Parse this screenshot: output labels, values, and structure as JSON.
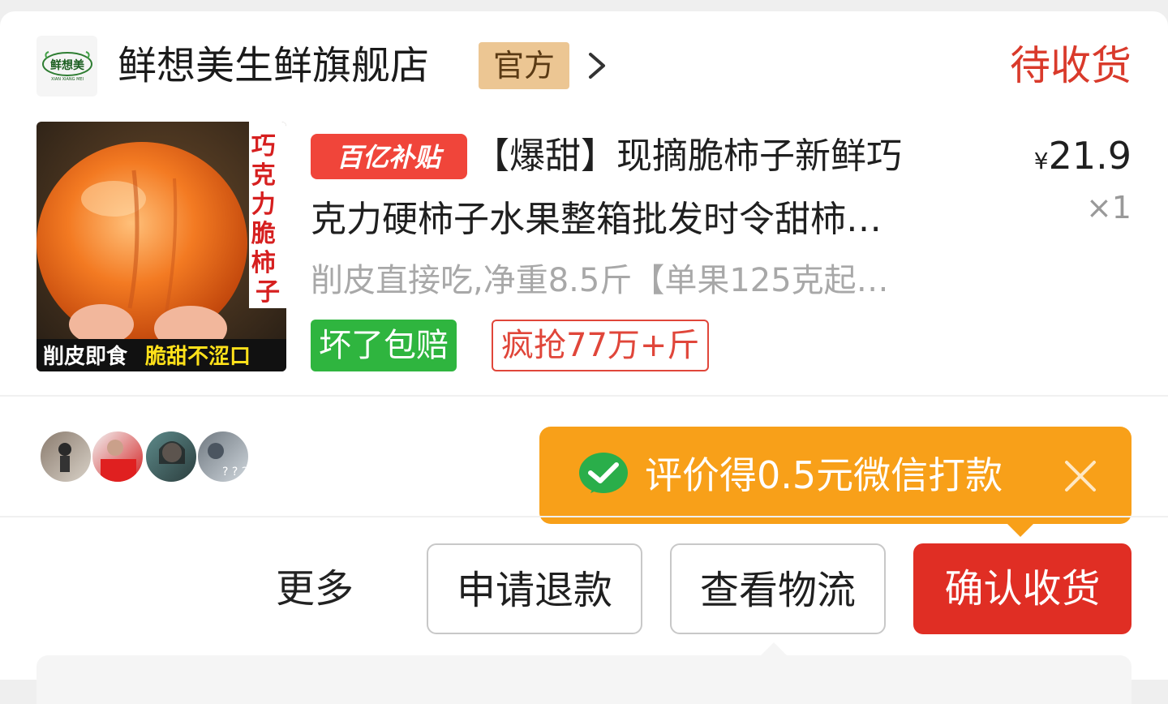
{
  "shop": {
    "name": "鲜想美生鲜旗舰店",
    "logo_text": "鲜想美",
    "logo_subtext": "XIAN XIANG MEI",
    "official_badge": "官方",
    "status": "待收货"
  },
  "product": {
    "thumb_vertical_text": "巧克力脆柿子",
    "thumb_bottom_text_1": "削皮即食",
    "thumb_bottom_text_2": "脆甜不涩口",
    "subsidy_badge": "百亿补贴",
    "title_line1": "【爆甜】现摘脆柿子新鲜巧",
    "title_line2": "克力硬柿子水果整箱批发时令甜柿…",
    "spec": "削皮直接吃,净重8.5斤【单果125克起…",
    "price_symbol": "¥",
    "price": "21.9",
    "quantity": "×1",
    "tag_guarantee": "坏了包赔",
    "tag_sales": "疯抢77万+斤"
  },
  "review_tip": {
    "text": "评价得0.5元微信打款"
  },
  "actions": {
    "more": "更多",
    "refund": "申请退款",
    "logistics": "查看物流",
    "confirm": "确认收货"
  },
  "colors": {
    "accent_red": "#e02e24",
    "status_red": "#d93a2b",
    "tooltip_orange": "#f8a019",
    "guarantee_green": "#2fb53f",
    "official_gold": "#ecc693"
  }
}
